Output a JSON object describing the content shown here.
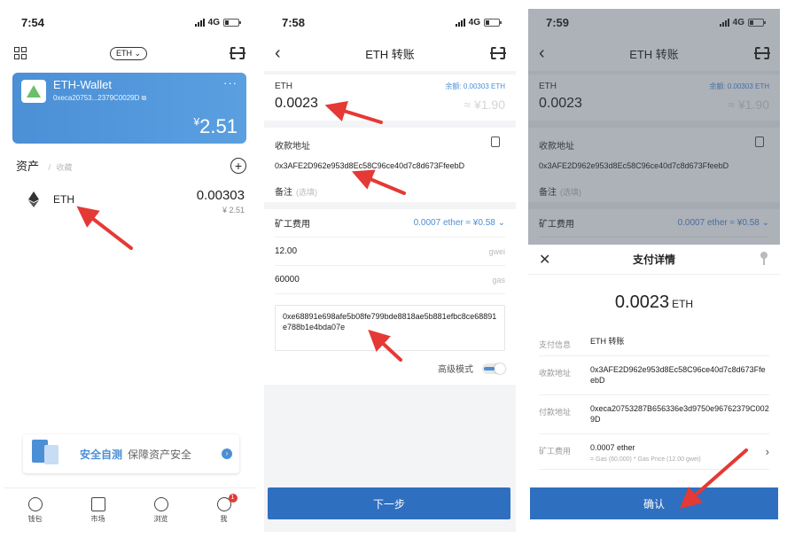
{
  "phone1": {
    "status_time": "7:54",
    "network": "4G",
    "coin_chip": "ETH",
    "wallet": {
      "name": "ETH-Wallet",
      "address": "0xeca20753...2379C0029D",
      "balance_symbol": "¥",
      "balance": "2.51",
      "more": "···"
    },
    "assets_title": "资产",
    "assets_divider": "/",
    "assets_sub": "收藏",
    "asset": {
      "name": "ETH",
      "amount": "0.00303",
      "fiat": "¥ 2.51"
    },
    "banner": {
      "main": "安全自测",
      "sub": "保障资产安全"
    },
    "tabs": [
      {
        "label": "钱包"
      },
      {
        "label": "市场"
      },
      {
        "label": "浏览"
      },
      {
        "label": "我",
        "badge": "1"
      }
    ]
  },
  "phone2": {
    "status_time": "7:58",
    "network": "4G",
    "title": "ETH 转账",
    "asset_label": "ETH",
    "balance_label": "余额: 0.00303 ETH",
    "amount": "0.0023",
    "amount_fiat": "≈ ¥1.90",
    "address_label": "收款地址",
    "address": "0x3AFE2D962e953d8Ec58C96ce40d7c8d673FfeebD",
    "memo_label": "备注",
    "memo_placeholder": "(选填)",
    "fee_label": "矿工费用",
    "fee_value": "0.0007 ether ≈ ¥0.58",
    "gas_price": "12.00",
    "gas_price_unit": "gwei",
    "gas_limit": "60000",
    "gas_limit_unit": "gas",
    "hex_data": "0xe68891e698afe5b08fe799bde8818ae5b881efbc8ce68891e788b1e4bda07e",
    "advanced_label": "高级模式",
    "next_button": "下一步"
  },
  "phone3": {
    "status_time": "7:59",
    "network": "4G",
    "title": "ETH 转账",
    "asset_label": "ETH",
    "balance_label": "余额: 0.00303 ETH",
    "amount": "0.0023",
    "amount_fiat": "≈ ¥1.90",
    "address_label": "收款地址",
    "address": "0x3AFE2D962e953d8Ec58C96ce40d7c8d673FfeebD",
    "memo_label": "备注",
    "memo_placeholder": "(选填)",
    "fee_label": "矿工费用",
    "fee_value": "0.0007 ether ≈ ¥0.58",
    "sheet": {
      "title": "支付详情",
      "amount": "0.0023",
      "unit": "ETH",
      "rows": [
        {
          "label": "支付信息",
          "value": "ETH 转账"
        },
        {
          "label": "收款地址",
          "value": "0x3AFE2D962e953d8Ec58C96ce40d7c8d673FfeebD"
        },
        {
          "label": "付款地址",
          "value": "0xeca20753287B656336e3d9750e96762379C0029D"
        },
        {
          "label": "矿工费用",
          "value": "0.0007 ether",
          "sub": "= Gas (60,000) * Gas Price (12.00 gwei)"
        }
      ],
      "confirm_button": "确认"
    }
  },
  "colors": {
    "accent": "#2e6fbf",
    "card": "#4b8fd6",
    "arrow": "#e53935"
  }
}
